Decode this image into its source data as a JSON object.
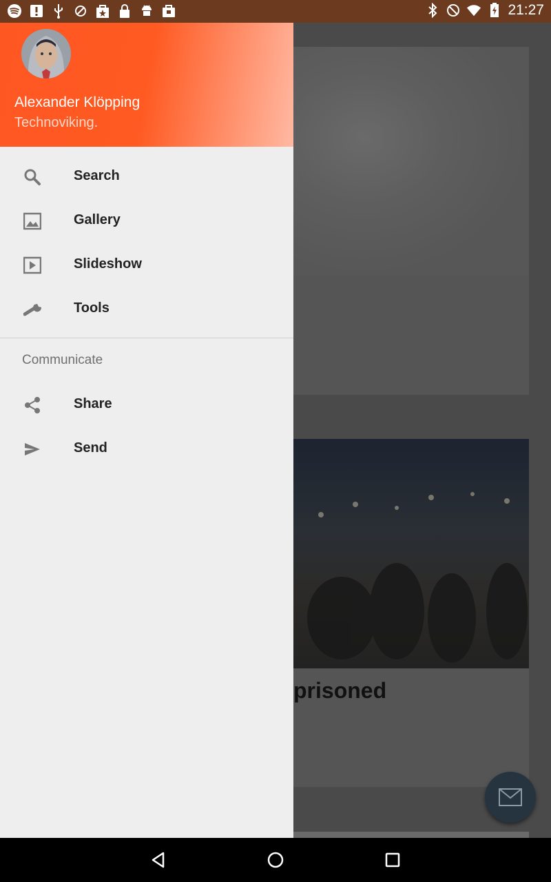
{
  "status_bar": {
    "time": "21:27",
    "left_icons": [
      "spotify-icon",
      "alert-icon",
      "usb-icon",
      "blocked-icon",
      "shopping-bag-icon",
      "lock-icon",
      "android-icon",
      "briefcase-icon"
    ],
    "right_icons": [
      "bluetooth-icon",
      "do-not-disturb-icon",
      "wifi-icon",
      "battery-charging-icon"
    ]
  },
  "drawer": {
    "user_name": "Alexander Klöpping",
    "user_subtitle": "Technoviking.",
    "menu": [
      {
        "label": "Search",
        "icon": "search-icon"
      },
      {
        "label": "Gallery",
        "icon": "gallery-icon"
      },
      {
        "label": "Slideshow",
        "icon": "slideshow-icon"
      },
      {
        "label": "Tools",
        "icon": "wrench-icon"
      }
    ],
    "section_title": "Communicate",
    "section_menu": [
      {
        "label": "Share",
        "icon": "share-icon"
      },
      {
        "label": "Send",
        "icon": "send-icon"
      }
    ]
  },
  "background": {
    "card2_title_fragment": "prisoned"
  },
  "fab": {
    "icon": "email-icon"
  },
  "navbar": {
    "icons": [
      "back-icon",
      "home-icon",
      "recents-icon"
    ]
  },
  "colors": {
    "header_orange": "#ff5722",
    "drawer_bg": "#eeeeee",
    "status_bar": "#6b3a1f"
  }
}
